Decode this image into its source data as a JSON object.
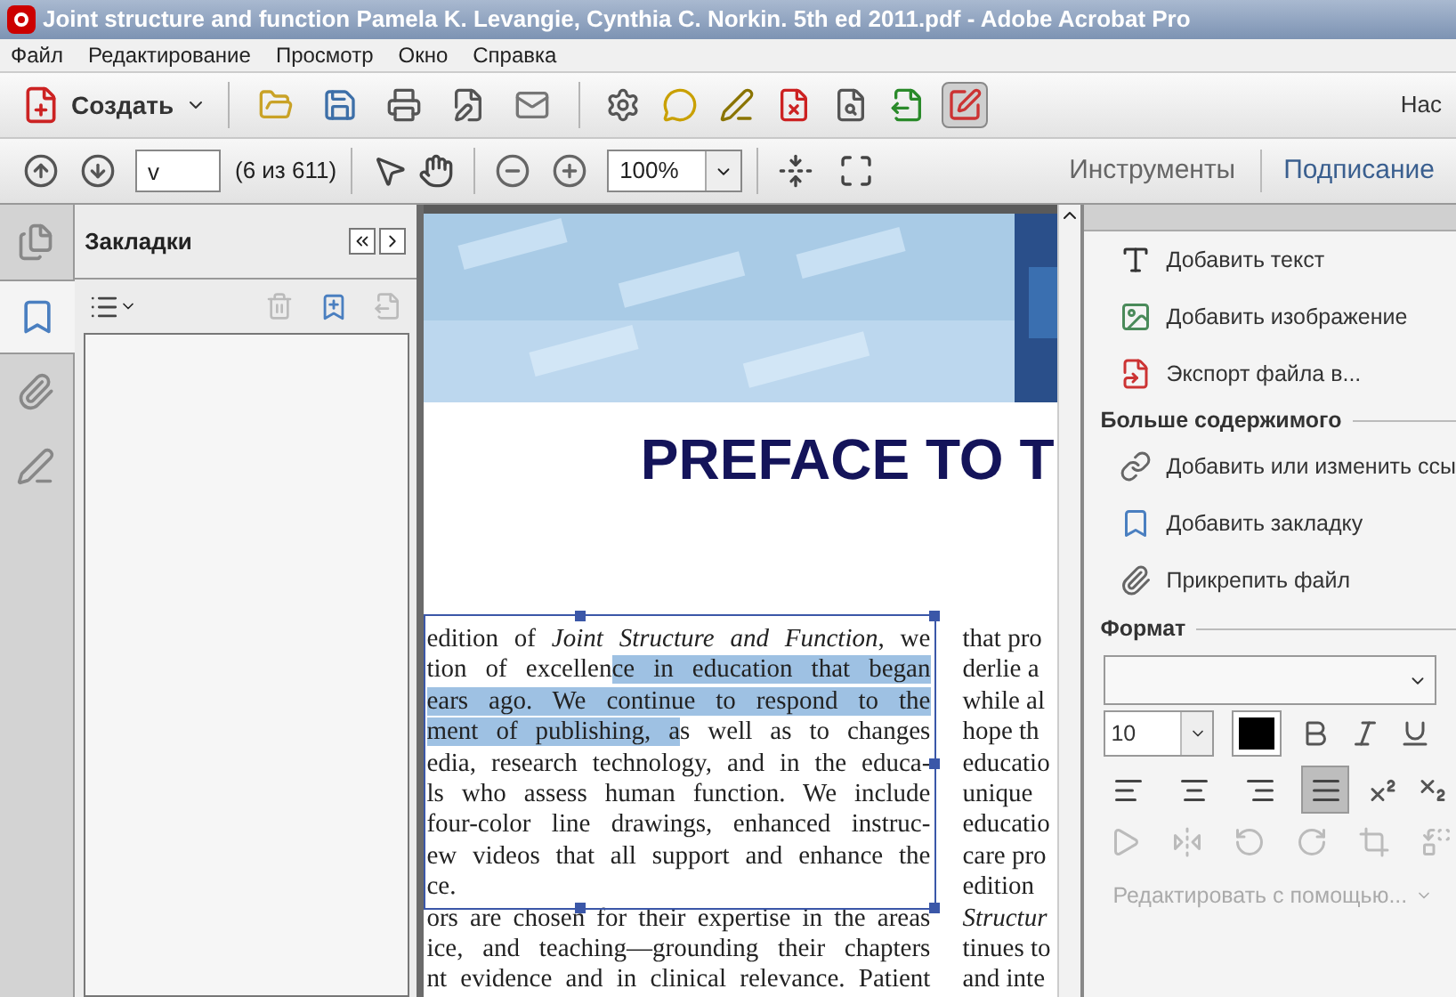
{
  "window": {
    "title": "Joint structure and function  Pamela K. Levangie, Cynthia C. Norkin. 5th ed 2011.pdf - Adobe Acrobat Pro"
  },
  "menu": [
    "Файл",
    "Редактирование",
    "Просмотр",
    "Окно",
    "Справка"
  ],
  "toolbar": {
    "create_label": "Создать",
    "right_text": "Нас",
    "quick_tools": [
      {
        "selected": false
      },
      {
        "selected": false
      },
      {
        "selected": false
      },
      {
        "selected": false
      },
      {
        "selected": false
      },
      {
        "selected": false
      },
      {
        "selected": false
      },
      {
        "selected": false
      },
      {
        "selected": false
      },
      {
        "selected": false
      },
      {
        "selected": false
      },
      {
        "selected": true
      }
    ]
  },
  "navigation": {
    "page_value": "v",
    "page_count": "(6 из 611)",
    "zoom": "100%",
    "tools_label": "Инструменты",
    "sign_label": "Подписание"
  },
  "left_rail": [
    {
      "selected": false
    },
    {
      "selected": true
    },
    {
      "selected": false
    },
    {
      "selected": false
    }
  ],
  "bookmarks": {
    "title": "Закладки"
  },
  "document": {
    "heading": "PREFACE TO T",
    "left_column": [
      [
        {
          "text": "edition of *Joint Structure and Function*, we",
          "selected": false
        }
      ],
      [
        {
          "text": "tion of excellen",
          "selected": false
        },
        {
          "text": "ce in education that began",
          "selected": true
        }
      ],
      [
        {
          "text": "ears ago. We continue to respond to the",
          "selected": true
        }
      ],
      [
        {
          "text": "ment of publishing, a",
          "selected": true
        },
        {
          "text": "s well as to changes",
          "selected": false
        }
      ],
      [
        {
          "text": "edia, research technology, and in the educa-",
          "selected": false
        }
      ],
      [
        {
          "text": "ls who assess human function. We include",
          "selected": false
        }
      ],
      [
        {
          "text": "four-color line drawings, enhanced instruc-",
          "selected": false
        }
      ],
      [
        {
          "text": "ew videos that all support and enhance the",
          "selected": false
        }
      ],
      [
        {
          "text": "ce.",
          "selected": false
        }
      ],
      [
        {
          "text": "ors are chosen for their expertise in the areas",
          "selected": false
        }
      ],
      [
        {
          "text": "ice, and teaching—grounding their chapters",
          "selected": false
        }
      ],
      [
        {
          "text": "nt evidence and in clinical relevance. Patient",
          "selected": false
        }
      ]
    ],
    "right_column": [
      "that pro",
      "derlie a",
      "while al",
      "hope th",
      "educatio",
      "unique",
      "educatio",
      "care pro",
      "edition",
      "*Structur*",
      "tinues to",
      "and inte"
    ]
  },
  "tools_panel": {
    "content_items": [
      "Добавить текст",
      "Добавить изображение",
      "Экспорт файла в..."
    ],
    "more_title": "Больше содержимого",
    "more_items": [
      "Добавить или изменить ссы",
      "Добавить закладку",
      "Прикрепить файл"
    ],
    "format_title": "Формат",
    "font_size": "10",
    "alignments": [
      {
        "selected": false
      },
      {
        "selected": false
      },
      {
        "selected": false
      },
      {
        "selected": true
      }
    ],
    "edit_with": {
      "label": "Редактировать с помощью...",
      "disabled": true
    }
  }
}
